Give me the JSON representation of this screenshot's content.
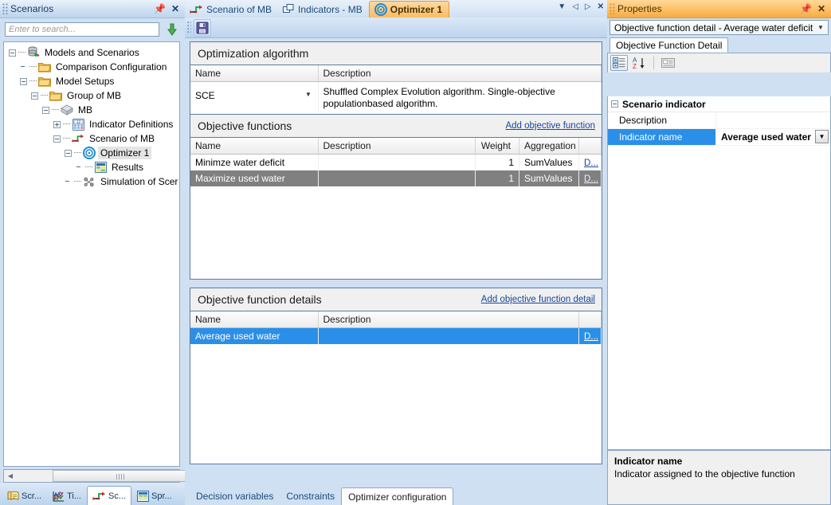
{
  "sidebar": {
    "title": "Scenarios",
    "pin_icon": "pin-icon",
    "close_icon": "close-icon",
    "search": {
      "placeholder": "Enter to search...",
      "value": "",
      "go_icon": "down-arrow-icon"
    },
    "tree": [
      {
        "label": "Models and Scenarios",
        "depth": 0,
        "expander": "minus",
        "icon": "database-scenario-icon",
        "selected": false
      },
      {
        "label": "Comparison Configuration",
        "depth": 1,
        "expander": "none",
        "icon": "folder-icon",
        "selected": false
      },
      {
        "label": "Model Setups",
        "depth": 1,
        "expander": "minus",
        "icon": "folder-icon",
        "selected": false
      },
      {
        "label": "Group of MB",
        "depth": 2,
        "expander": "minus",
        "icon": "folder-icon",
        "selected": false
      },
      {
        "label": "MB",
        "depth": 3,
        "expander": "minus",
        "icon": "model-icon",
        "selected": false
      },
      {
        "label": "Indicator Definitions",
        "depth": 4,
        "expander": "plus",
        "icon": "calculator-icon",
        "selected": false
      },
      {
        "label": "Scenario of MB",
        "depth": 4,
        "expander": "minus",
        "icon": "scenario-icon",
        "selected": false
      },
      {
        "label": "Optimizer 1",
        "depth": 5,
        "expander": "minus",
        "icon": "optimizer-icon",
        "selected": true
      },
      {
        "label": "Results",
        "depth": 6,
        "expander": "none",
        "icon": "results-icon",
        "selected": false
      },
      {
        "label": "Simulation of Scer",
        "depth": 5,
        "expander": "none",
        "icon": "simulation-icon",
        "selected": false
      }
    ],
    "hscroll": {
      "left_arrow": "left-arrow-icon",
      "right_arrow": "right-arrow-icon"
    },
    "doc_tabs": [
      {
        "label": "Scr...",
        "icon": "scenarios-icon",
        "active": false
      },
      {
        "label": "Ti...",
        "icon": "timeseries-icon",
        "active": false
      },
      {
        "label": "Sc...",
        "icon": "scenario-icon",
        "active": true
      },
      {
        "label": "Spr...",
        "icon": "spreadsheet-icon",
        "active": false
      }
    ]
  },
  "center": {
    "tabs": [
      {
        "label": "Scenario of MB",
        "icon": "scenario-icon",
        "active": false
      },
      {
        "label": "Indicators - MB",
        "icon": "indicators-icon",
        "active": false
      },
      {
        "label": "Optimizer 1",
        "icon": "optimizer-icon",
        "active": true
      }
    ],
    "tabnav": {
      "dropdown_icon": "chevron-down-icon",
      "prev_icon": "prev-arrow-icon",
      "next_icon": "next-arrow-icon",
      "close_icon": "close-icon"
    },
    "toolbar": {
      "save_icon": "save-icon"
    },
    "algorithm_section": {
      "title": "Optimization algorithm",
      "columns": [
        "Name",
        "Description"
      ],
      "rows": [
        {
          "name": "SCE",
          "description": "Shuffled Complex Evolution algorithm. Single-objective populationbased algorithm.",
          "dropdown_icon": "chevron-down-icon"
        }
      ]
    },
    "objective_functions_section": {
      "title": "Objective functions",
      "add_link": "Add objective function",
      "columns": [
        "Name",
        "Description",
        "Weight",
        "Aggregation",
        ""
      ],
      "rows": [
        {
          "name": "Minimze water deficit",
          "description": "",
          "weight": "1",
          "aggregation": "SumValues",
          "detail_link": "D...",
          "selected": false
        },
        {
          "name": "Maximize used water",
          "description": "",
          "weight": "1",
          "aggregation": "SumValues",
          "detail_link": "D...",
          "selected": true
        }
      ]
    },
    "objective_function_details_section": {
      "title": "Objective function details",
      "add_link": "Add objective function detail",
      "columns": [
        "Name",
        "Description",
        ""
      ],
      "rows": [
        {
          "name": "Average used water",
          "description": "",
          "detail_link": "D...",
          "selected": true
        }
      ]
    },
    "view_tabs": [
      {
        "label": "Decision variables",
        "active": false
      },
      {
        "label": "Constraints",
        "active": false
      },
      {
        "label": "Optimizer configuration",
        "active": true
      }
    ]
  },
  "properties": {
    "title": "Properties",
    "pin_icon": "pin-icon",
    "close_icon": "close-icon",
    "object_selector": {
      "value": "Objective function detail - Average water deficit",
      "arrow_icon": "chevron-down-icon"
    },
    "tabs": [
      {
        "label": "Objective Function Detail",
        "active": true
      }
    ],
    "toolbar": [
      {
        "icon": "categorized-icon",
        "active": true
      },
      {
        "icon": "alphabetical-sort-icon",
        "active": false
      },
      {
        "icon": "property-pages-icon",
        "active": false
      }
    ],
    "grid": {
      "category": "Scenario indicator",
      "category_expander": "minus",
      "rows": [
        {
          "name": "Description",
          "value": "",
          "selected": false,
          "has_dropdown": false
        },
        {
          "name": "Indicator name",
          "value": "Average used water",
          "selected": true,
          "has_dropdown": true,
          "dropdown_icon": "chevron-down-icon"
        }
      ]
    },
    "description": {
      "title": "Indicator name",
      "text": "Indicator assigned to the objective function"
    }
  },
  "colors": {
    "accent_orange": "#f9bd62",
    "selection_blue": "#2a8fe8",
    "selection_gray": "#808080",
    "link_blue": "#16469c",
    "panel_blue": "#cfe0f2"
  }
}
